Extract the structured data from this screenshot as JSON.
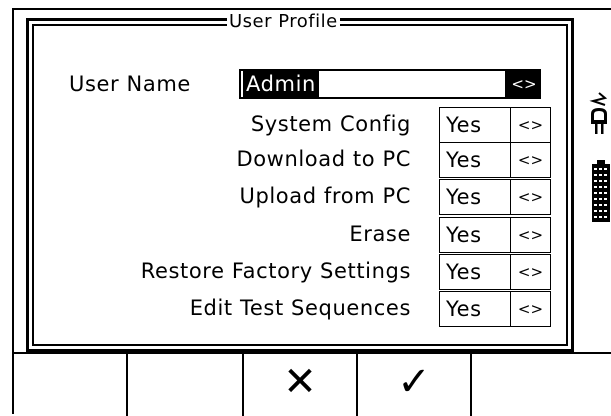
{
  "dialog": {
    "title": "User Profile",
    "username_label": "User Name",
    "username_value": "Admin",
    "username_arrow": "<>"
  },
  "rows": [
    {
      "label": "System Config",
      "value": "Yes",
      "arrow": "<>"
    },
    {
      "label": "Download to PC",
      "value": "Yes",
      "arrow": "<>"
    },
    {
      "label": "Upload from PC",
      "value": "Yes",
      "arrow": "<>"
    },
    {
      "label": "Erase",
      "value": "Yes",
      "arrow": "<>"
    },
    {
      "label": "Restore Factory Settings",
      "value": "Yes",
      "arrow": "<>"
    },
    {
      "label": "Edit Test Sequences",
      "value": "Yes",
      "arrow": "<>"
    }
  ],
  "softkeys": {
    "cancel_glyph": "✕",
    "confirm_glyph": "✓"
  },
  "icons": [
    "plug-icon",
    "battery-icon",
    "cancel-icon",
    "check-icon"
  ]
}
